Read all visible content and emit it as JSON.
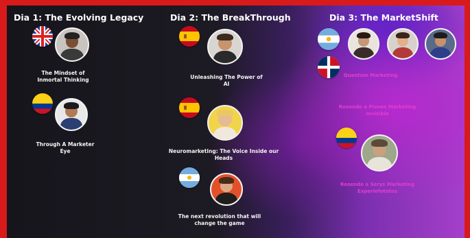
{
  "days": [
    {
      "title": "Dia 1: The Evolving Legacy",
      "talks": [
        {
          "caption": "The Mindset of Inmortal Thinking",
          "flag": "uk-flag-icon"
        },
        {
          "caption": "Through A Marketer Eye",
          "flag": "colombia-flag-icon"
        }
      ]
    },
    {
      "title": "Dia 2: The BreakThrough",
      "talks": [
        {
          "caption": "Unleashing The Power of AI",
          "flag": "spain-flag-icon"
        },
        {
          "caption": "Neuromarketing: The Voice Inside our Heads",
          "flag": "spain-flag-icon"
        },
        {
          "caption": "The next revolution that will change the game",
          "flag": "argentina-flag-icon"
        }
      ]
    },
    {
      "title": "Dia 3: The MarketShift",
      "talks": [
        {
          "caption": "Quantum Marketing",
          "flag": "argentina-flag-icon"
        },
        {
          "caption": "Rosendo a Piones Marketing Invisible",
          "flag": "dominican-republic-flag-icon"
        },
        {
          "caption": "Rosendo a Serys Marketing Experiefototos",
          "flag": "colombia-flag-icon"
        }
      ]
    }
  ],
  "colors": {
    "background_frame": "#d81a1a",
    "text": "#ffffff",
    "accent_pink": "#e23ecf"
  }
}
